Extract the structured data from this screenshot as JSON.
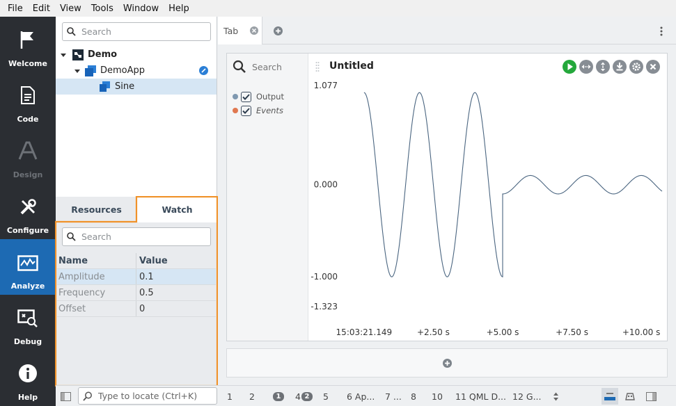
{
  "menu": [
    "File",
    "Edit",
    "View",
    "Tools",
    "Window",
    "Help"
  ],
  "modes": [
    {
      "label": "Welcome",
      "icon": "flag-icon"
    },
    {
      "label": "Code",
      "icon": "document-icon"
    },
    {
      "label": "Design",
      "icon": "design-icon",
      "disabled": true
    },
    {
      "label": "Configure",
      "icon": "wrench-icon"
    },
    {
      "label": "Analyze",
      "icon": "analyze-icon",
      "active": true
    },
    {
      "label": "Debug",
      "icon": "debug-icon"
    },
    {
      "label": "Help",
      "icon": "info-icon"
    }
  ],
  "nav": {
    "search_placeholder": "Search",
    "tree": [
      {
        "label": "Demo",
        "level": 0,
        "bold": true
      },
      {
        "label": "DemoApp",
        "level": 1
      },
      {
        "label": "Sine",
        "level": 2,
        "selected": true
      }
    ]
  },
  "lower_tabs": {
    "resources": "Resources",
    "watch": "Watch"
  },
  "watch": {
    "search_placeholder": "Search",
    "headers": {
      "name": "Name",
      "value": "Value"
    },
    "rows": [
      {
        "name": "Amplitude",
        "value": "0.1",
        "selected": true
      },
      {
        "name": "Frequency",
        "value": "0.5"
      },
      {
        "name": "Offset",
        "value": "0"
      }
    ]
  },
  "editor": {
    "tab_label": "Tab",
    "plot": {
      "search_placeholder": "Search",
      "title": "Untitled",
      "legend": [
        {
          "name": "Output",
          "color": "#7f98b0",
          "checked": true
        },
        {
          "name": "Events",
          "color": "#e07850",
          "checked": true
        }
      ]
    }
  },
  "chart_data": {
    "type": "line",
    "title": "Untitled",
    "xlabel": "",
    "ylabel": "",
    "x_tick_labels": [
      "15:03:21.149",
      "+2.50 s",
      "+5.00 s",
      "+7.50 s",
      "+10.00 s"
    ],
    "x_ticks_seconds": [
      0,
      2.5,
      5.0,
      7.5,
      10.0
    ],
    "y_tick_labels": [
      "1.077",
      "0.000",
      "-1.000",
      "-1.323"
    ],
    "y_ticks": [
      1.077,
      0.0,
      -1.0,
      -1.323
    ],
    "xlim": [
      -0.75,
      10.75
    ],
    "ylim": [
      -1.323,
      1.077
    ],
    "series": [
      {
        "name": "Output",
        "color": "#4a6580",
        "segments": [
          {
            "x_range": [
              0.0,
              5.0
            ],
            "amplitude": 1.0,
            "frequency_hz": 0.5,
            "phase_deg": 90
          },
          {
            "x_range": [
              5.0,
              10.75
            ],
            "amplitude": 0.1,
            "frequency_hz": 0.5,
            "phase_deg": 90
          }
        ]
      }
    ],
    "grid": false,
    "legend_position": "left"
  },
  "statusbar": {
    "locate_placeholder": "Type to locate (Ctrl+K)",
    "items": [
      "1",
      "2",
      "3",
      "4",
      "5",
      "6  Ap...",
      "7  ...",
      "8",
      "10",
      "11  QML D...",
      "12  G..."
    ],
    "badges": {
      "3": "1",
      "4": "2"
    }
  }
}
